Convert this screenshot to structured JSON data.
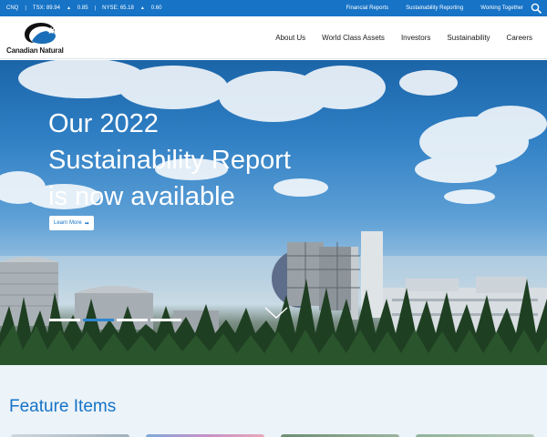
{
  "topbar": {
    "ticker_symbol": "CNQ",
    "tsx_label": "TSX: 89.94",
    "tsx_change": "0.85",
    "nyse_label": "NYSE: 65.18",
    "nyse_change": "0.60",
    "separator": "|",
    "up_arrow": "▲",
    "links": [
      "Financial Reports",
      "Sustainability Reporting",
      "Working Together"
    ],
    "search_icon": "search-icon"
  },
  "header": {
    "logo_text": "Canadian Natural",
    "nav": [
      "About Us",
      "World Class Assets",
      "Investors",
      "Sustainability",
      "Careers"
    ]
  },
  "hero": {
    "title_lines": [
      "Our 2022",
      "Sustainability Report",
      "is now available"
    ],
    "button_label": "Learn More",
    "button_arrow": "➡",
    "slides": 4,
    "active_slide": 2
  },
  "feature": {
    "heading": "Feature Items"
  },
  "colors": {
    "brand_blue": "#1673c6",
    "white": "#ffffff",
    "feature_bg": "#ecf3f9"
  }
}
